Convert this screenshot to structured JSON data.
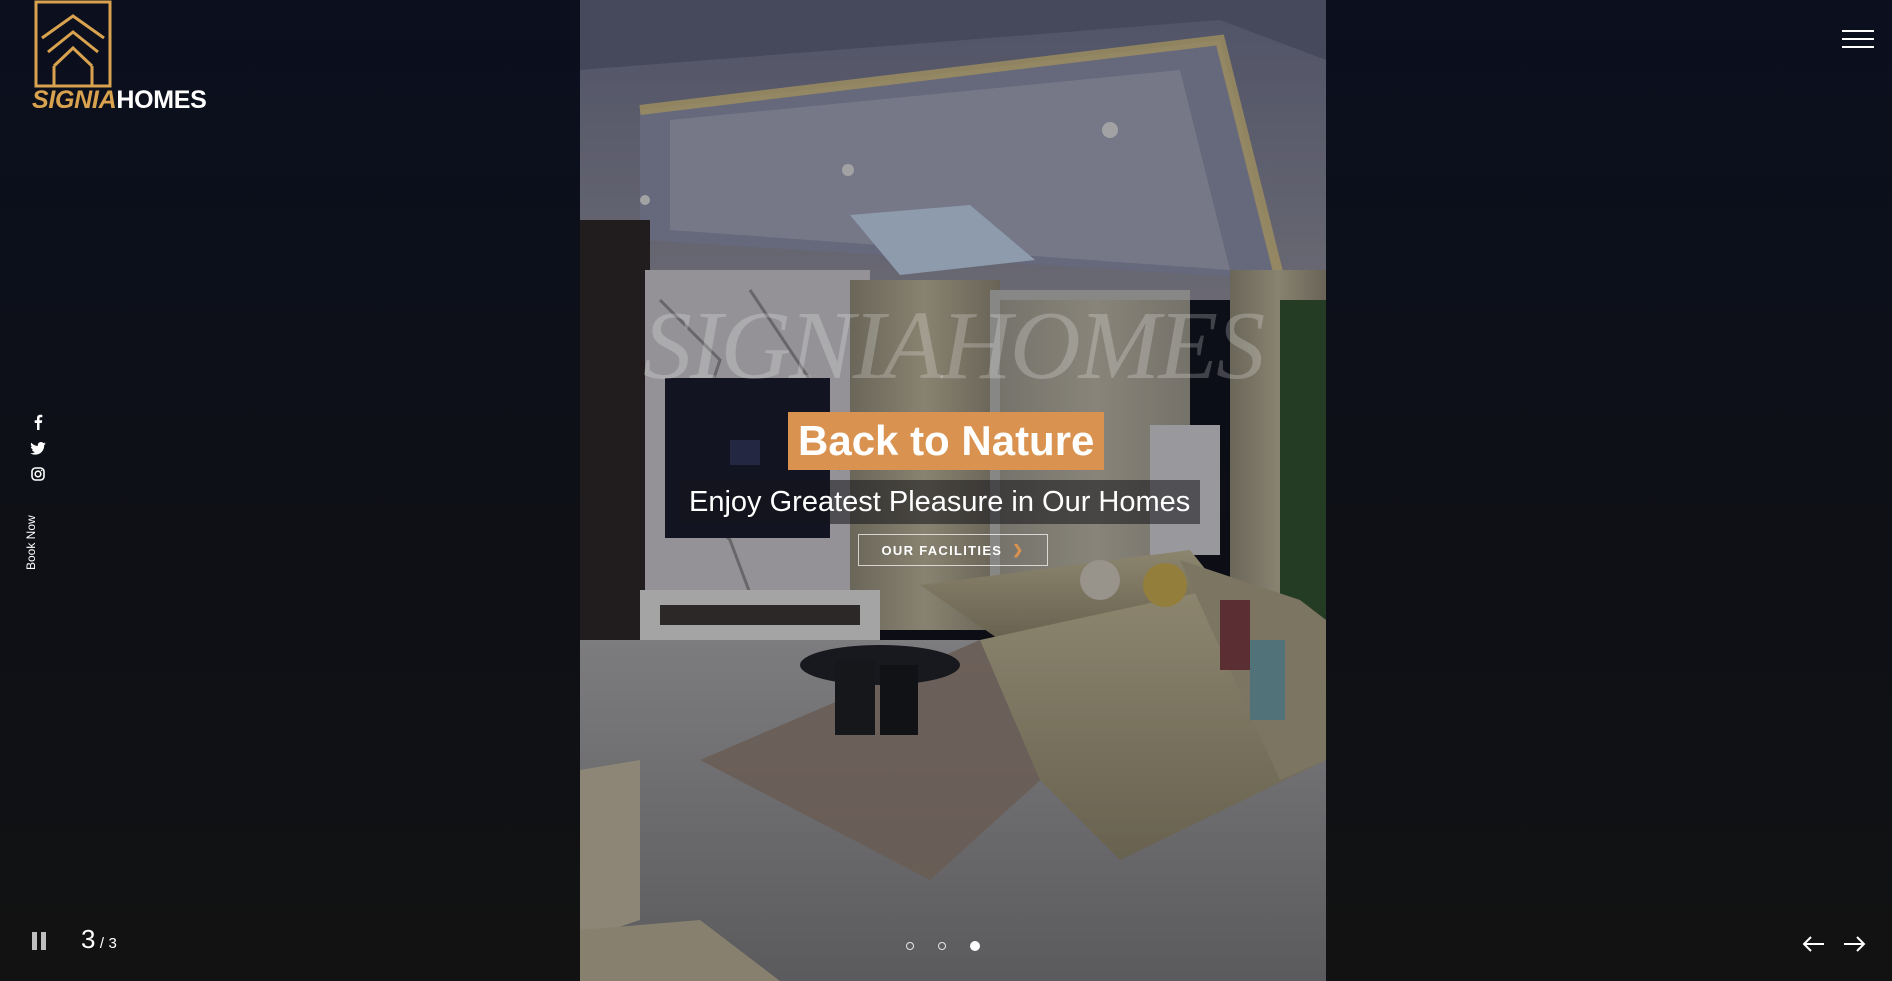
{
  "brand": {
    "name_part1": "SIGNIA",
    "name_part2": "HOMES",
    "accent_color": "#d9a24f"
  },
  "menu": {
    "icon": "hamburger-menu-icon"
  },
  "social": [
    {
      "name": "facebook",
      "icon": "facebook-icon"
    },
    {
      "name": "twitter",
      "icon": "twitter-icon"
    },
    {
      "name": "instagram",
      "icon": "instagram-icon"
    }
  ],
  "sidebar": {
    "book_now": "Book Now"
  },
  "hero": {
    "watermark": "SIGNIAHOMES",
    "title": "Back to Nature",
    "title_bg_color": "#d9924f",
    "subtitle": "Enjoy Greatest Pleasure in Our Homes",
    "cta_label": "OUR FACILITIES",
    "cta_icon": "chevron-right-icon"
  },
  "slider": {
    "current": "3",
    "separator": "/",
    "total": "3",
    "active_index": 3,
    "dot_count": 3,
    "pause_icon": "pause-icon",
    "prev_icon": "arrow-left-icon",
    "next_icon": "arrow-right-icon"
  }
}
